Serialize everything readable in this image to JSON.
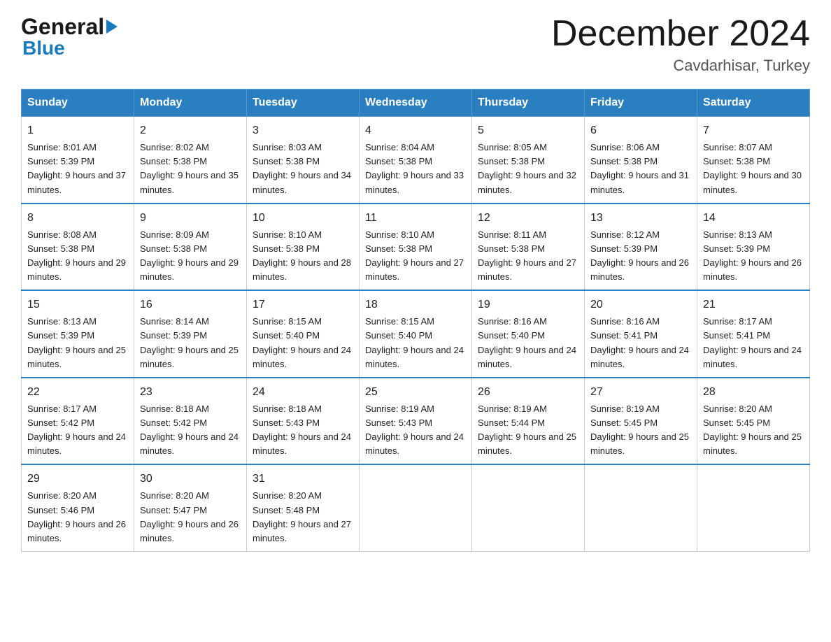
{
  "header": {
    "logo_line1_black": "General",
    "logo_line1_blue": "▶",
    "logo_line2": "Blue",
    "month_title": "December 2024",
    "location": "Cavdarhisar, Turkey"
  },
  "weekdays": [
    "Sunday",
    "Monday",
    "Tuesday",
    "Wednesday",
    "Thursday",
    "Friday",
    "Saturday"
  ],
  "weeks": [
    [
      {
        "day": "1",
        "sunrise": "Sunrise: 8:01 AM",
        "sunset": "Sunset: 5:39 PM",
        "daylight": "Daylight: 9 hours and 37 minutes."
      },
      {
        "day": "2",
        "sunrise": "Sunrise: 8:02 AM",
        "sunset": "Sunset: 5:38 PM",
        "daylight": "Daylight: 9 hours and 35 minutes."
      },
      {
        "day": "3",
        "sunrise": "Sunrise: 8:03 AM",
        "sunset": "Sunset: 5:38 PM",
        "daylight": "Daylight: 9 hours and 34 minutes."
      },
      {
        "day": "4",
        "sunrise": "Sunrise: 8:04 AM",
        "sunset": "Sunset: 5:38 PM",
        "daylight": "Daylight: 9 hours and 33 minutes."
      },
      {
        "day": "5",
        "sunrise": "Sunrise: 8:05 AM",
        "sunset": "Sunset: 5:38 PM",
        "daylight": "Daylight: 9 hours and 32 minutes."
      },
      {
        "day": "6",
        "sunrise": "Sunrise: 8:06 AM",
        "sunset": "Sunset: 5:38 PM",
        "daylight": "Daylight: 9 hours and 31 minutes."
      },
      {
        "day": "7",
        "sunrise": "Sunrise: 8:07 AM",
        "sunset": "Sunset: 5:38 PM",
        "daylight": "Daylight: 9 hours and 30 minutes."
      }
    ],
    [
      {
        "day": "8",
        "sunrise": "Sunrise: 8:08 AM",
        "sunset": "Sunset: 5:38 PM",
        "daylight": "Daylight: 9 hours and 29 minutes."
      },
      {
        "day": "9",
        "sunrise": "Sunrise: 8:09 AM",
        "sunset": "Sunset: 5:38 PM",
        "daylight": "Daylight: 9 hours and 29 minutes."
      },
      {
        "day": "10",
        "sunrise": "Sunrise: 8:10 AM",
        "sunset": "Sunset: 5:38 PM",
        "daylight": "Daylight: 9 hours and 28 minutes."
      },
      {
        "day": "11",
        "sunrise": "Sunrise: 8:10 AM",
        "sunset": "Sunset: 5:38 PM",
        "daylight": "Daylight: 9 hours and 27 minutes."
      },
      {
        "day": "12",
        "sunrise": "Sunrise: 8:11 AM",
        "sunset": "Sunset: 5:38 PM",
        "daylight": "Daylight: 9 hours and 27 minutes."
      },
      {
        "day": "13",
        "sunrise": "Sunrise: 8:12 AM",
        "sunset": "Sunset: 5:39 PM",
        "daylight": "Daylight: 9 hours and 26 minutes."
      },
      {
        "day": "14",
        "sunrise": "Sunrise: 8:13 AM",
        "sunset": "Sunset: 5:39 PM",
        "daylight": "Daylight: 9 hours and 26 minutes."
      }
    ],
    [
      {
        "day": "15",
        "sunrise": "Sunrise: 8:13 AM",
        "sunset": "Sunset: 5:39 PM",
        "daylight": "Daylight: 9 hours and 25 minutes."
      },
      {
        "day": "16",
        "sunrise": "Sunrise: 8:14 AM",
        "sunset": "Sunset: 5:39 PM",
        "daylight": "Daylight: 9 hours and 25 minutes."
      },
      {
        "day": "17",
        "sunrise": "Sunrise: 8:15 AM",
        "sunset": "Sunset: 5:40 PM",
        "daylight": "Daylight: 9 hours and 24 minutes."
      },
      {
        "day": "18",
        "sunrise": "Sunrise: 8:15 AM",
        "sunset": "Sunset: 5:40 PM",
        "daylight": "Daylight: 9 hours and 24 minutes."
      },
      {
        "day": "19",
        "sunrise": "Sunrise: 8:16 AM",
        "sunset": "Sunset: 5:40 PM",
        "daylight": "Daylight: 9 hours and 24 minutes."
      },
      {
        "day": "20",
        "sunrise": "Sunrise: 8:16 AM",
        "sunset": "Sunset: 5:41 PM",
        "daylight": "Daylight: 9 hours and 24 minutes."
      },
      {
        "day": "21",
        "sunrise": "Sunrise: 8:17 AM",
        "sunset": "Sunset: 5:41 PM",
        "daylight": "Daylight: 9 hours and 24 minutes."
      }
    ],
    [
      {
        "day": "22",
        "sunrise": "Sunrise: 8:17 AM",
        "sunset": "Sunset: 5:42 PM",
        "daylight": "Daylight: 9 hours and 24 minutes."
      },
      {
        "day": "23",
        "sunrise": "Sunrise: 8:18 AM",
        "sunset": "Sunset: 5:42 PM",
        "daylight": "Daylight: 9 hours and 24 minutes."
      },
      {
        "day": "24",
        "sunrise": "Sunrise: 8:18 AM",
        "sunset": "Sunset: 5:43 PM",
        "daylight": "Daylight: 9 hours and 24 minutes."
      },
      {
        "day": "25",
        "sunrise": "Sunrise: 8:19 AM",
        "sunset": "Sunset: 5:43 PM",
        "daylight": "Daylight: 9 hours and 24 minutes."
      },
      {
        "day": "26",
        "sunrise": "Sunrise: 8:19 AM",
        "sunset": "Sunset: 5:44 PM",
        "daylight": "Daylight: 9 hours and 25 minutes."
      },
      {
        "day": "27",
        "sunrise": "Sunrise: 8:19 AM",
        "sunset": "Sunset: 5:45 PM",
        "daylight": "Daylight: 9 hours and 25 minutes."
      },
      {
        "day": "28",
        "sunrise": "Sunrise: 8:20 AM",
        "sunset": "Sunset: 5:45 PM",
        "daylight": "Daylight: 9 hours and 25 minutes."
      }
    ],
    [
      {
        "day": "29",
        "sunrise": "Sunrise: 8:20 AM",
        "sunset": "Sunset: 5:46 PM",
        "daylight": "Daylight: 9 hours and 26 minutes."
      },
      {
        "day": "30",
        "sunrise": "Sunrise: 8:20 AM",
        "sunset": "Sunset: 5:47 PM",
        "daylight": "Daylight: 9 hours and 26 minutes."
      },
      {
        "day": "31",
        "sunrise": "Sunrise: 8:20 AM",
        "sunset": "Sunset: 5:48 PM",
        "daylight": "Daylight: 9 hours and 27 minutes."
      },
      null,
      null,
      null,
      null
    ]
  ]
}
